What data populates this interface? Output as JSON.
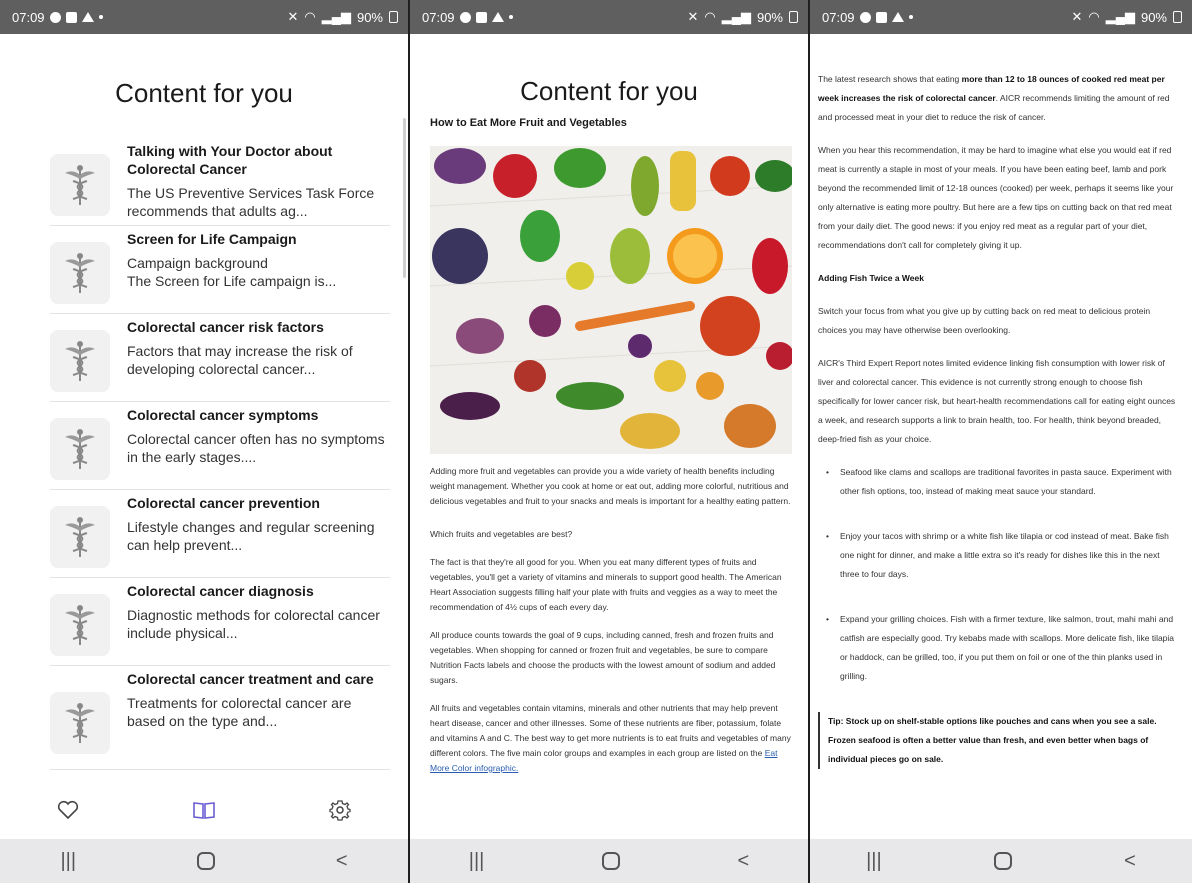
{
  "status_bar": {
    "time": "07:09",
    "battery": "90%"
  },
  "screen1": {
    "title": "Content for you",
    "items": [
      {
        "title": "Talking with Your Doctor about Colorectal Cancer",
        "desc": "The US Preventive Services Task Force recommends that adults ag..."
      },
      {
        "title": "Screen for Life Campaign",
        "desc": "Campaign background\nThe Screen for Life campaign is..."
      },
      {
        "title": "Colorectal cancer risk factors",
        "desc": "Factors that may increase the risk of developing colorectal cancer..."
      },
      {
        "title": "Colorectal cancer symptoms",
        "desc": "Colorectal cancer often has no symptoms in the early stages...."
      },
      {
        "title": "Colorectal cancer prevention",
        "desc": "Lifestyle changes and regular screening can help prevent..."
      },
      {
        "title": "Colorectal cancer diagnosis",
        "desc": "Diagnostic methods for colorectal cancer include physical..."
      },
      {
        "title": "Colorectal cancer treatment and care",
        "desc": "Treatments for colorectal cancer are based on the type and..."
      }
    ],
    "tabs": {
      "active": "library"
    },
    "accent_color": "#6b5fd3"
  },
  "screen2": {
    "title": "Content for you",
    "subtitle": "How to Eat More Fruit and Vegetables",
    "p1": "Adding more fruit and vegetables can provide you a wide variety of health benefits including weight management. Whether you cook at home or eat out, adding more colorful, nutritious and delicious vegetables and fruit to your snacks and meals is important for a healthy eating pattern.",
    "q": "Which fruits and vegetables are best?",
    "p2": "The fact is that they're all good for you. When you eat many different types of fruits and vegetables, you'll get a variety of vitamins and minerals to support good health. The American Heart Association suggests filling half your plate with fruits and veggies as a way to meet the recommendation of 4½ cups of each every day.",
    "p3": "All produce counts towards the goal of 9 cups, including canned, fresh and frozen fruits and vegetables. When shopping for canned or frozen fruit and vegetables, be sure to compare Nutrition Facts labels and choose the products with the lowest amount of sodium and added sugars.",
    "p4": "All fruits and vegetables contain vitamins, minerals and other nutrients that may help prevent heart disease, cancer and other illnesses. Some of these nutrients are fiber, potassium, folate and vitamins A and C. The best way to get more nutrients is to eat fruits and vegetables of many different colors. The five main color groups and examples in each group are listed on the",
    "link": "Eat More Color infographic."
  },
  "screen3": {
    "p1_a": "The latest research shows that eating ",
    "p1_b": "more than 12 to 18 ounces of cooked red meat per week increases the risk of colorectal cancer",
    "p1_c": ". AICR recommends limiting the amount of red and processed meat in your diet to reduce the risk of cancer.",
    "p2": "When you hear this recommendation, it may be hard to imagine what else you would eat if red meat is currently a staple in most of your meals. If you have been eating beef, lamb and pork beyond the recommended limit of 12-18 ounces (cooked) per week, perhaps it seems like your only alternative is eating more poultry. But here are a few tips on cutting back on that red meat from your daily diet. The good news: if you enjoy red meat as a regular part of your diet, recommendations don't call for completely giving it up.",
    "heading": "Adding Fish Twice a Week",
    "p3": "Switch your focus from what you give up by cutting back on red meat to delicious protein choices you may have otherwise been overlooking.",
    "p4": "AICR's Third Expert Report notes limited evidence linking fish consumption with lower risk of liver and colorectal cancer. This evidence is not currently strong enough to choose fish specifically for lower cancer risk, but heart-health recommendations call for eating eight ounces a week, and research supports a link to brain health, too. For health, think beyond breaded, deep-fried fish as your choice.",
    "bullets": [
      "Seafood like clams and scallops are traditional favorites in pasta sauce. Experiment with other fish options, too, instead of making meat sauce your standard.",
      "Enjoy your tacos with shrimp or a white fish like tilapia or cod instead of meat. Bake fish one night for dinner, and make a little extra so it's ready for dishes like this in the next three to four days.",
      "Expand your grilling choices. Fish with a firmer texture, like salmon, trout, mahi mahi and catfish are especially good. Try kebabs made with scallops. More delicate fish, like tilapia or haddock, can be grilled, too, if you put them on foil or one of the thin planks used in grilling."
    ],
    "tip": "Tip: Stock up on shelf-stable options like pouches and cans when you see a sale. Frozen seafood is often a better value than fresh, and even better when bags of individual pieces go on sale."
  }
}
